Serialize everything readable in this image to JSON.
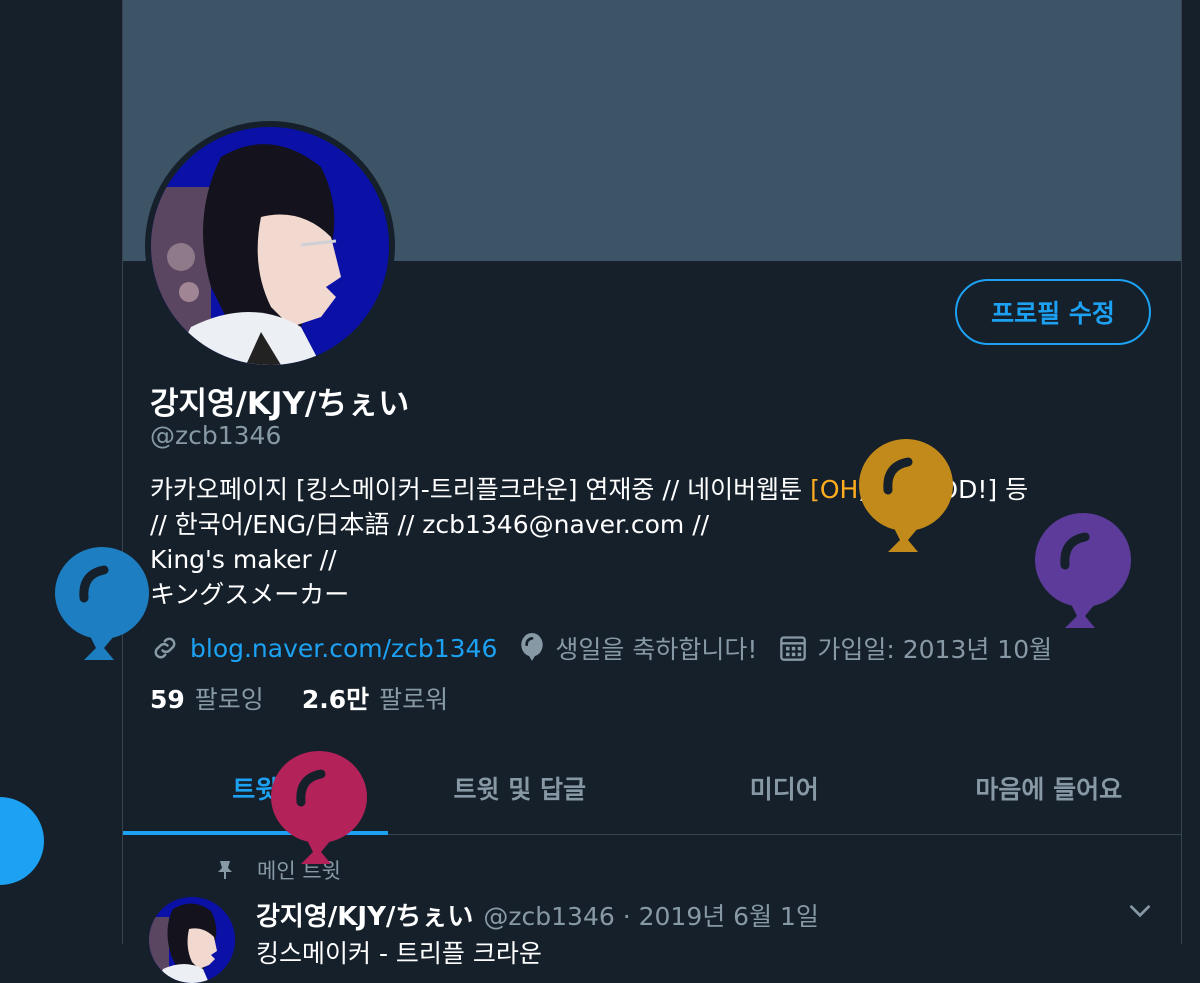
{
  "profile": {
    "name": "강지영/KJY/ちぇい",
    "handle": "@zcb1346",
    "edit_button": "프로필 수정",
    "bio": {
      "line1_pre": "카카오페이지 [킹스메이커-트리플크라운] 연재중 // 네이버웹툰 ",
      "line1_hl": "[OH",
      "line1_post": ", MY GOD!] 등",
      "line2": "// 한국어/ENG/日本語 // zcb1346@naver.com //",
      "line3": "King's maker //",
      "line4": "キングスメーカー"
    },
    "link": "blog.naver.com/zcb1346",
    "birthday": "생일을 축하합니다!",
    "joined": "가입일: 2013년 10월",
    "following_count": "59",
    "following_label": "팔로잉",
    "followers_count": "2.6만",
    "followers_label": "팔로워"
  },
  "tabs": [
    {
      "label": "트윗"
    },
    {
      "label": "트윗 및 답글"
    },
    {
      "label": "미디어"
    },
    {
      "label": "마음에 들어요"
    }
  ],
  "pinned_tweet": {
    "label": "메인 트윗",
    "author": "강지영/KJY/ちぇい",
    "meta": "@zcb1346 · 2019년 6월 1일",
    "text": "킹스메이커 - 트리플 크라운"
  },
  "colors": {
    "background": "#15202b",
    "banner": "#3d5466",
    "accent": "#1da1f2",
    "muted": "#8899a6",
    "balloon_yellow": "#c28a1a",
    "balloon_purple": "#5d3b9a",
    "balloon_blue": "#1d7fc2",
    "balloon_red": "#b4225a"
  },
  "icons": [
    "link-icon",
    "balloon-icon",
    "calendar-icon",
    "pin-icon",
    "chevron-down-icon"
  ]
}
